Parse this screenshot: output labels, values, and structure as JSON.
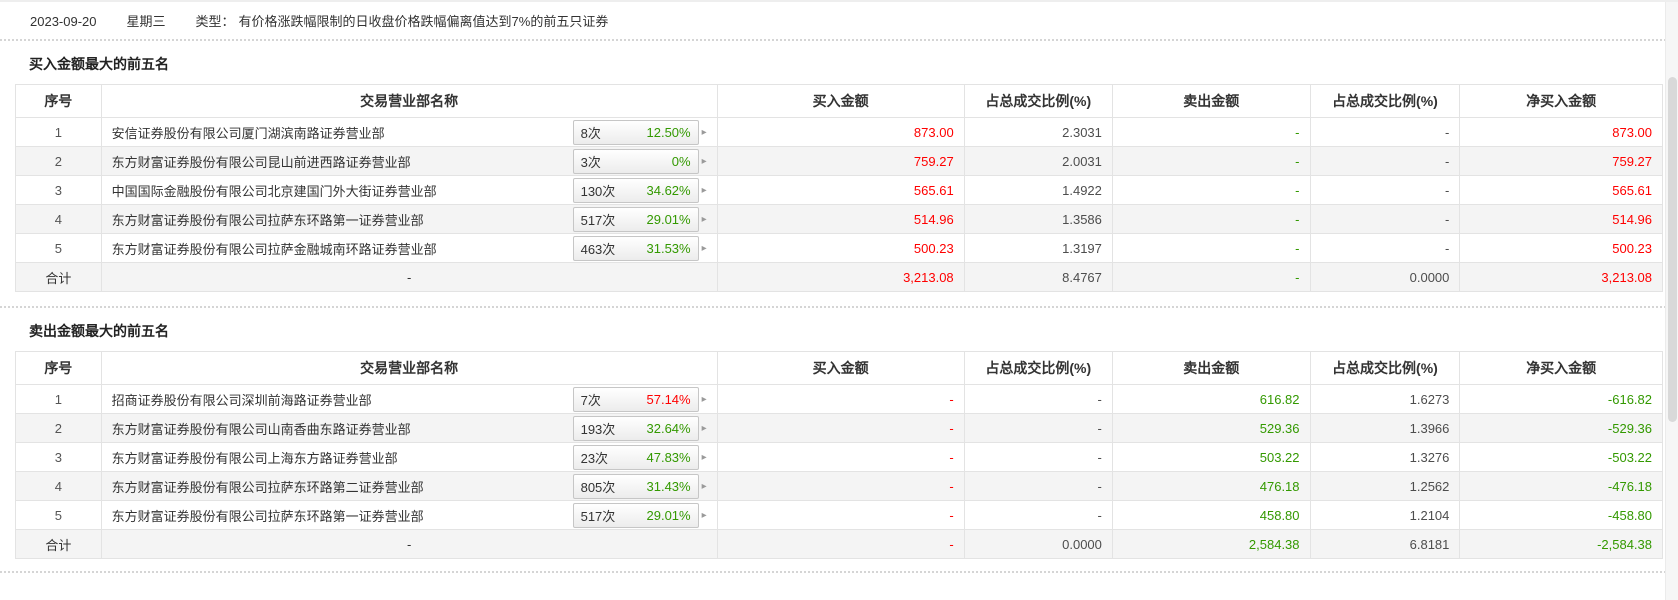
{
  "topbar": {
    "date": "2023-09-20",
    "weekday": "星期三",
    "type_label": "类型：",
    "type_text": "有价格涨跌幅限制的日收盘价格跌幅偏离值达到7%的前五只证券"
  },
  "table": {
    "columns": [
      "序号",
      "交易营业部名称",
      "买入金额",
      "占总成交比例(%)",
      "卖出金额",
      "占总成交比例(%)",
      "净买入金额"
    ]
  },
  "icons": {
    "expand_arrow": "▸"
  },
  "colors": {
    "buy_red": "#ff0000",
    "sell_green": "#339900",
    "neutral": "#4d4d4d"
  },
  "sections": [
    {
      "title": "买入金额最大的前五名",
      "rows": [
        {
          "no": "1",
          "name": "安信证券股份有限公司厦门湖滨南路证券营业部",
          "badge": {
            "count": "8次",
            "pct": "12.50%",
            "pct_color": "green"
          },
          "cells": {
            "buy": {
              "v": "873.00",
              "c": "red"
            },
            "buy_ratio": {
              "v": "2.3031",
              "c": "dark"
            },
            "sell": {
              "v": "-",
              "c": "green"
            },
            "sell_ratio": {
              "v": "-",
              "c": "dark"
            },
            "net": {
              "v": "873.00",
              "c": "red"
            }
          }
        },
        {
          "no": "2",
          "name": "东方财富证券股份有限公司昆山前进西路证券营业部",
          "badge": {
            "count": "3次",
            "pct": "0%",
            "pct_color": "green"
          },
          "cells": {
            "buy": {
              "v": "759.27",
              "c": "red"
            },
            "buy_ratio": {
              "v": "2.0031",
              "c": "dark"
            },
            "sell": {
              "v": "-",
              "c": "green"
            },
            "sell_ratio": {
              "v": "-",
              "c": "dark"
            },
            "net": {
              "v": "759.27",
              "c": "red"
            }
          }
        },
        {
          "no": "3",
          "name": "中国国际金融股份有限公司北京建国门外大街证券营业部",
          "badge": {
            "count": "130次",
            "pct": "34.62%",
            "pct_color": "green"
          },
          "cells": {
            "buy": {
              "v": "565.61",
              "c": "red"
            },
            "buy_ratio": {
              "v": "1.4922",
              "c": "dark"
            },
            "sell": {
              "v": "-",
              "c": "green"
            },
            "sell_ratio": {
              "v": "-",
              "c": "dark"
            },
            "net": {
              "v": "565.61",
              "c": "red"
            }
          }
        },
        {
          "no": "4",
          "name": "东方财富证券股份有限公司拉萨东环路第一证券营业部",
          "badge": {
            "count": "517次",
            "pct": "29.01%",
            "pct_color": "green"
          },
          "cells": {
            "buy": {
              "v": "514.96",
              "c": "red"
            },
            "buy_ratio": {
              "v": "1.3586",
              "c": "dark"
            },
            "sell": {
              "v": "-",
              "c": "green"
            },
            "sell_ratio": {
              "v": "-",
              "c": "dark"
            },
            "net": {
              "v": "514.96",
              "c": "red"
            }
          }
        },
        {
          "no": "5",
          "name": "东方财富证券股份有限公司拉萨金融城南环路证券营业部",
          "badge": {
            "count": "463次",
            "pct": "31.53%",
            "pct_color": "green"
          },
          "cells": {
            "buy": {
              "v": "500.23",
              "c": "red"
            },
            "buy_ratio": {
              "v": "1.3197",
              "c": "dark"
            },
            "sell": {
              "v": "-",
              "c": "green"
            },
            "sell_ratio": {
              "v": "-",
              "c": "dark"
            },
            "net": {
              "v": "500.23",
              "c": "red"
            }
          }
        }
      ],
      "total": {
        "no": "合计",
        "name": "-",
        "cells": {
          "buy": {
            "v": "3,213.08",
            "c": "red"
          },
          "buy_ratio": {
            "v": "8.4767",
            "c": "dark"
          },
          "sell": {
            "v": "-",
            "c": "green"
          },
          "sell_ratio": {
            "v": "0.0000",
            "c": "dark"
          },
          "net": {
            "v": "3,213.08",
            "c": "red"
          }
        }
      }
    },
    {
      "title": "卖出金额最大的前五名",
      "rows": [
        {
          "no": "1",
          "name": "招商证券股份有限公司深圳前海路证券营业部",
          "badge": {
            "count": "7次",
            "pct": "57.14%",
            "pct_color": "red"
          },
          "cells": {
            "buy": {
              "v": "-",
              "c": "red"
            },
            "buy_ratio": {
              "v": "-",
              "c": "dark"
            },
            "sell": {
              "v": "616.82",
              "c": "green"
            },
            "sell_ratio": {
              "v": "1.6273",
              "c": "dark"
            },
            "net": {
              "v": "-616.82",
              "c": "green"
            }
          }
        },
        {
          "no": "2",
          "name": "东方财富证券股份有限公司山南香曲东路证券营业部",
          "badge": {
            "count": "193次",
            "pct": "32.64%",
            "pct_color": "green"
          },
          "cells": {
            "buy": {
              "v": "-",
              "c": "red"
            },
            "buy_ratio": {
              "v": "-",
              "c": "dark"
            },
            "sell": {
              "v": "529.36",
              "c": "green"
            },
            "sell_ratio": {
              "v": "1.3966",
              "c": "dark"
            },
            "net": {
              "v": "-529.36",
              "c": "green"
            }
          }
        },
        {
          "no": "3",
          "name": "东方财富证券股份有限公司上海东方路证券营业部",
          "badge": {
            "count": "23次",
            "pct": "47.83%",
            "pct_color": "green"
          },
          "cells": {
            "buy": {
              "v": "-",
              "c": "red"
            },
            "buy_ratio": {
              "v": "-",
              "c": "dark"
            },
            "sell": {
              "v": "503.22",
              "c": "green"
            },
            "sell_ratio": {
              "v": "1.3276",
              "c": "dark"
            },
            "net": {
              "v": "-503.22",
              "c": "green"
            }
          }
        },
        {
          "no": "4",
          "name": "东方财富证券股份有限公司拉萨东环路第二证券营业部",
          "badge": {
            "count": "805次",
            "pct": "31.43%",
            "pct_color": "green"
          },
          "cells": {
            "buy": {
              "v": "-",
              "c": "red"
            },
            "buy_ratio": {
              "v": "-",
              "c": "dark"
            },
            "sell": {
              "v": "476.18",
              "c": "green"
            },
            "sell_ratio": {
              "v": "1.2562",
              "c": "dark"
            },
            "net": {
              "v": "-476.18",
              "c": "green"
            }
          }
        },
        {
          "no": "5",
          "name": "东方财富证券股份有限公司拉萨东环路第一证券营业部",
          "badge": {
            "count": "517次",
            "pct": "29.01%",
            "pct_color": "green"
          },
          "cells": {
            "buy": {
              "v": "-",
              "c": "red"
            },
            "buy_ratio": {
              "v": "-",
              "c": "dark"
            },
            "sell": {
              "v": "458.80",
              "c": "green"
            },
            "sell_ratio": {
              "v": "1.2104",
              "c": "dark"
            },
            "net": {
              "v": "-458.80",
              "c": "green"
            }
          }
        }
      ],
      "total": {
        "no": "合计",
        "name": "-",
        "cells": {
          "buy": {
            "v": "-",
            "c": "red"
          },
          "buy_ratio": {
            "v": "0.0000",
            "c": "dark"
          },
          "sell": {
            "v": "2,584.38",
            "c": "green"
          },
          "sell_ratio": {
            "v": "6.8181",
            "c": "dark"
          },
          "net": {
            "v": "-2,584.38",
            "c": "green"
          }
        }
      }
    }
  ]
}
